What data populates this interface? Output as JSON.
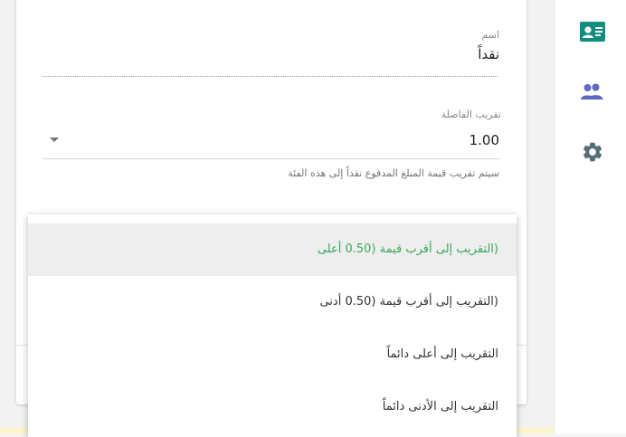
{
  "form": {
    "name_label": "اسم",
    "name_value": "نقداً",
    "rounding_label": "تقريب الفاصلة",
    "rounding_value": "1.00",
    "hint": "سيتم تقريب قيمة المبلغ المدفوع نقداً إلى هذه الفئة"
  },
  "menu": {
    "items": [
      {
        "label": "(التقريب إلى أقرب قيمة (0.50 أعلى"
      },
      {
        "label": "(التقريب إلى أقرب قيمة (0.50 أدنى"
      },
      {
        "label": "التقريب إلى أعلى دائماً"
      },
      {
        "label": "التقريب إلى الأدنى دائماً"
      }
    ],
    "selected_index": 0
  },
  "sidebar": {
    "icons": [
      "contact-card-icon",
      "people-icon",
      "gear-icon"
    ]
  },
  "colors": {
    "accent_green": "#3aa75a",
    "rail_teal": "#0f8d7e",
    "rail_indigo": "#5c6bc0",
    "rail_slate": "#546e7a"
  }
}
